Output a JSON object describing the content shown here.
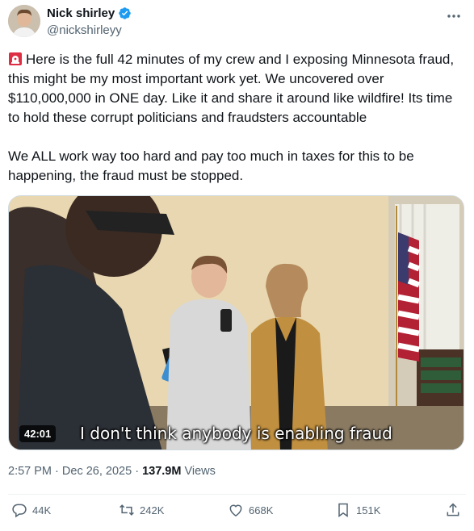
{
  "author": {
    "name": "Nick shirley",
    "handle": "@nickshirleyy",
    "verified": true
  },
  "tweet": {
    "paragraph1": "Here is the full 42 minutes of my crew and I exposing Minnesota fraud, this might be my most important work yet. We uncovered over $110,000,000 in ONE day. Like it and share it around like wildfire! Its time to hold these corrupt politicians and fraudsters accountable",
    "paragraph2": "We ALL work way too hard and pay too much in taxes for this to be happening, the fraud must be stopped."
  },
  "media": {
    "duration": "42:01",
    "caption": "I don't think anybody is enabling fraud"
  },
  "meta": {
    "time": "2:57 PM",
    "separator": "·",
    "date": "Dec 26, 2025",
    "views_count": "137.9M",
    "views_label": "Views"
  },
  "actions": {
    "replies": "44K",
    "reposts": "242K",
    "likes": "668K",
    "bookmarks": "151K"
  },
  "colors": {
    "accent": "#1d9bf0",
    "text": "#0f1419",
    "secondary": "#536471"
  },
  "icons": [
    "verified-badge-icon",
    "more-icon",
    "siren-emoji-icon",
    "reply-icon",
    "repost-icon",
    "like-icon",
    "bookmark-icon",
    "share-icon"
  ]
}
